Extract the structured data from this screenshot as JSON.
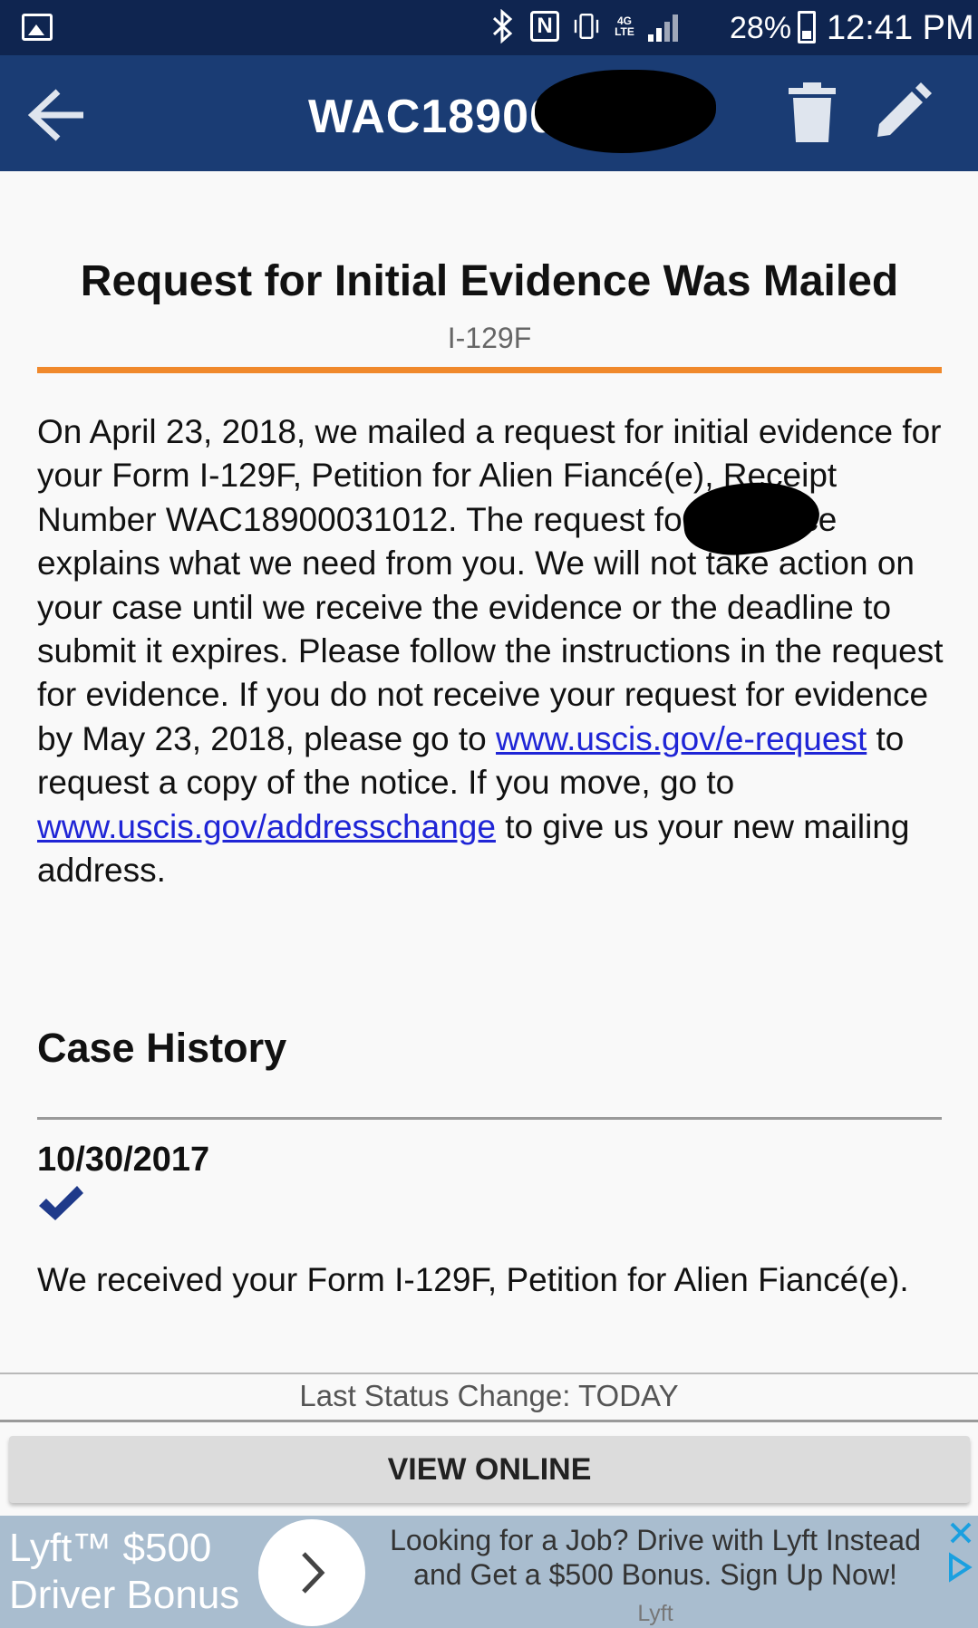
{
  "status_bar": {
    "battery_percent": "28%",
    "time": "12:41 PM",
    "network_label": "4G LTE",
    "nfc_label": "N",
    "icons": [
      "gallery-icon",
      "bluetooth-icon",
      "nfc-icon",
      "vibrate-icon",
      "network-icon",
      "signal-icon",
      "battery-icon"
    ]
  },
  "app_bar": {
    "receipt_number_visible": "WAC18900",
    "icons": [
      "back-arrow-icon",
      "trash-icon",
      "edit-pencil-icon"
    ]
  },
  "case": {
    "status_title": "Request for Initial Evidence Was Mailed",
    "form_type": "I-129F",
    "description_part1": "On April 23, 2018, we mailed a request for initial evidence for your Form I-129F, Petition for Alien Fiancé(e), Receipt Number WAC18900031012. The request for evidence explains what we need from you. We will not take action on your case until we receive the evidence or the deadline to submit it expires. Please follow the instructions in the request for evidence. If you do not receive your request for evidence by May 23, 2018, please go to ",
    "link_erequest": "www.uscis.gov/e-request",
    "description_part2": " to request a copy of the notice. If you move, go to ",
    "link_addresschange": "www.uscis.gov/addresschange",
    "description_part3": " to give us your new mailing address."
  },
  "case_history": {
    "heading": "Case History",
    "entries": [
      {
        "date": "10/30/2017",
        "text": "We received your Form I-129F, Petition for Alien Fiancé(e)."
      }
    ]
  },
  "footer": {
    "last_status": "Last Status Change: TODAY",
    "view_online_label": "VIEW ONLINE"
  },
  "ad": {
    "title": "Lyft™ $500 Driver Bonus",
    "body": "Looking for a Job? Drive with Lyft Instead and Get a $500 Bonus. Sign Up Now!",
    "sponsor": "Lyft"
  },
  "colors": {
    "status_bar": "#0f2550",
    "app_bar": "#1a3c74",
    "accent_rule": "#f0892c",
    "link": "#1f25d6",
    "check": "#1f3a8a",
    "ad_background": "#a9bdcf"
  }
}
